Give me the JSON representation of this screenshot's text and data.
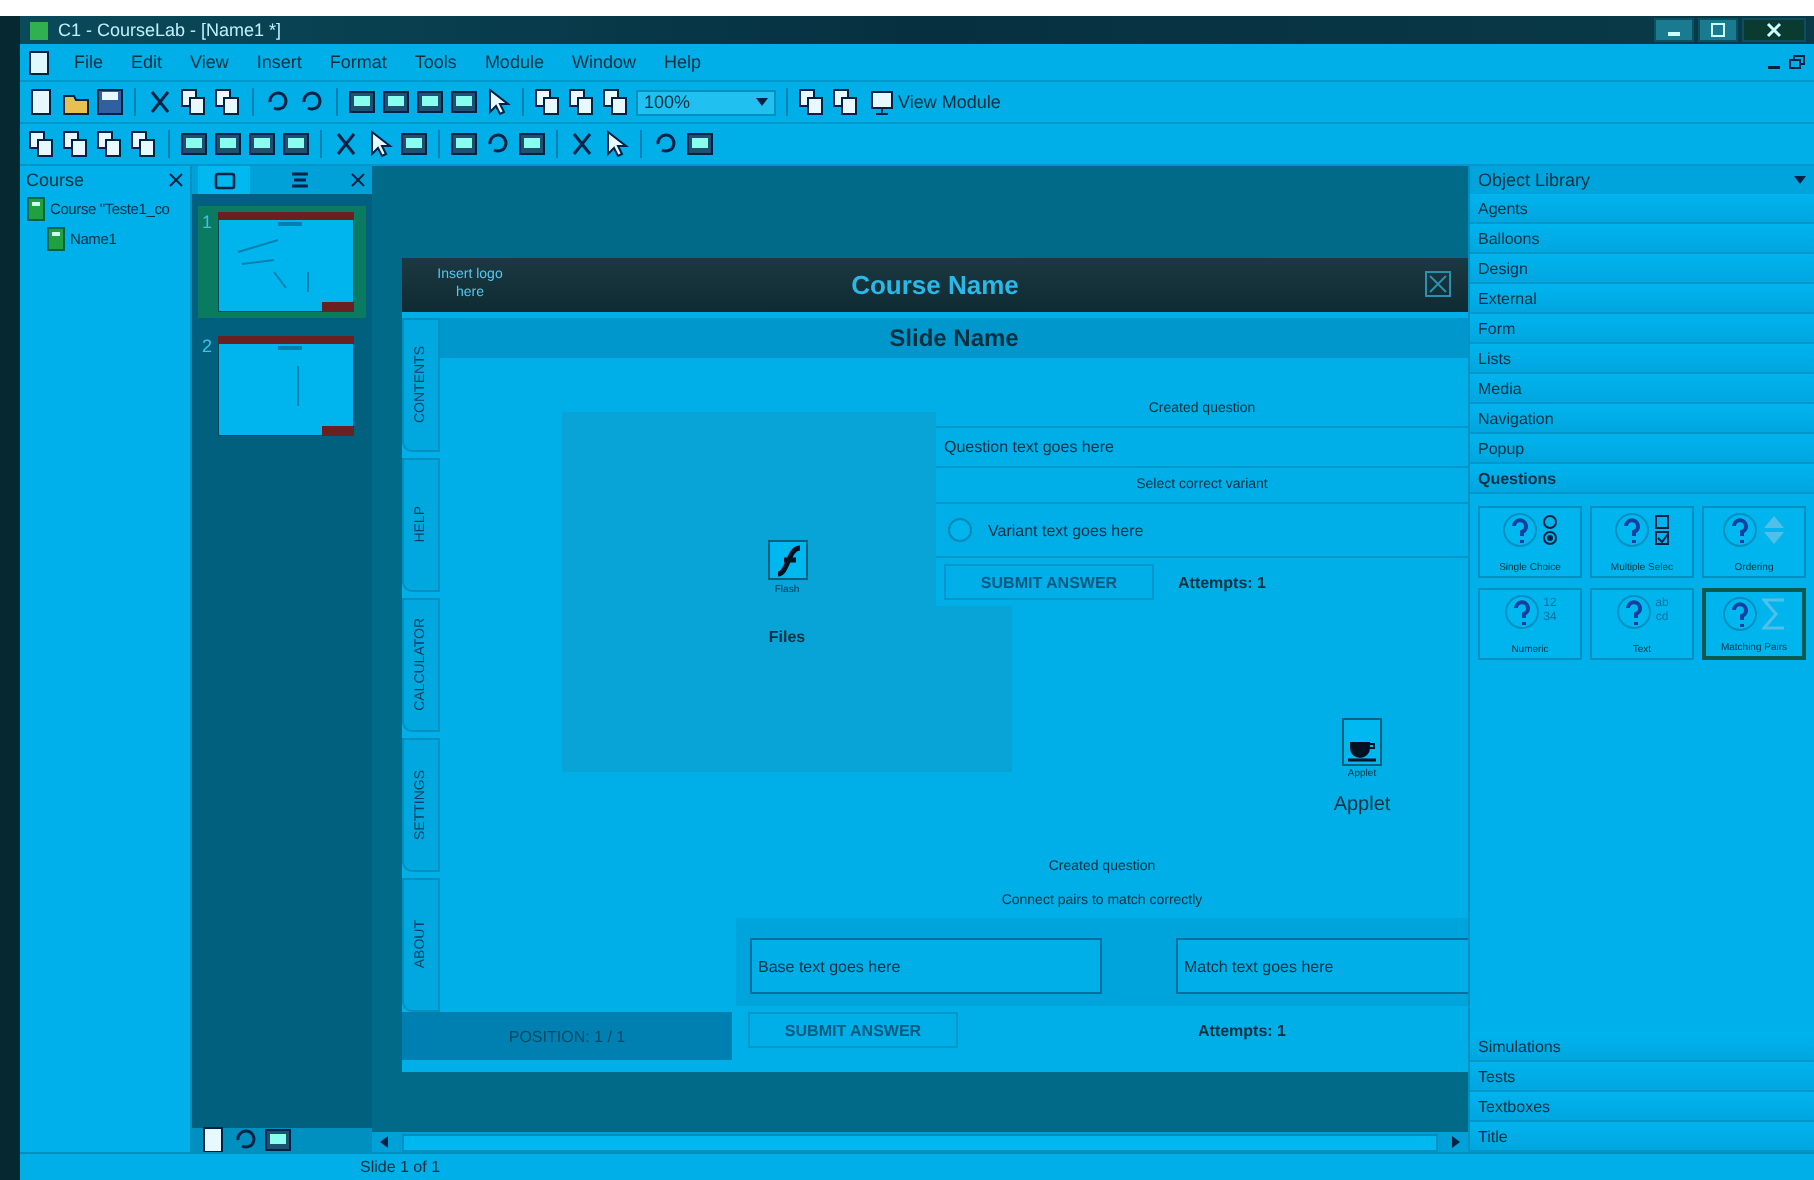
{
  "window": {
    "title": "C1 - CourseLab - [Name1 *]"
  },
  "menu": [
    "File",
    "Edit",
    "View",
    "Insert",
    "Format",
    "Tools",
    "Module",
    "Window",
    "Help"
  ],
  "toolbar": {
    "zoom": "100%",
    "view_module": "View Module"
  },
  "course_panel": {
    "title": "Course",
    "tree": [
      {
        "label": "Course \"Teste1_co",
        "children": [
          {
            "label": "Name1"
          }
        ]
      }
    ]
  },
  "slides_panel": {
    "thumbnails": [
      {
        "number": "1",
        "selected": true
      },
      {
        "number": "2",
        "selected": false
      }
    ]
  },
  "slide": {
    "logo": "Insert logo here",
    "course_name": "Course Name",
    "slide_name": "Slide Name",
    "side_tabs": [
      "CONTENTS",
      "HELP",
      "CALCULATOR",
      "SETTINGS",
      "ABOUT"
    ],
    "position": "POSITION: 1 / 1",
    "flash": {
      "icon_label": "Flash",
      "label": "Files"
    },
    "applet": {
      "icon_label": "Applet",
      "label": "Applet"
    },
    "question_1": {
      "heading": "Created question",
      "text": "Question text goes here",
      "instruction": "Select correct variant",
      "variants": [
        {
          "label": "Variant text goes here",
          "selected": false
        }
      ],
      "submit": {
        "label": "SUBMIT ANSWER",
        "disabled": true
      },
      "attempts": "Attempts: 1"
    },
    "question_2": {
      "heading": "Created question",
      "instruction": "Connect pairs to match correctly",
      "base": "Base text goes here",
      "match": "Match text goes here",
      "submit": {
        "label": "SUBMIT ANSWER",
        "disabled": true
      },
      "attempts": "Attempts: 1"
    }
  },
  "library": {
    "title": "Object Library",
    "groups_above": [
      {
        "label": "Agents"
      },
      {
        "label": "Balloons"
      },
      {
        "label": "Design"
      },
      {
        "label": "External"
      },
      {
        "label": "Form"
      },
      {
        "label": "Lists"
      },
      {
        "label": "Media"
      },
      {
        "label": "Navigation"
      },
      {
        "label": "Popup"
      }
    ],
    "open_group": {
      "label": "Questions",
      "expanded": true,
      "tiles": [
        {
          "label": "Single Choice",
          "kind": "radio",
          "selected": false
        },
        {
          "label": "Multiple Selec",
          "kind": "checkbox",
          "selected": false
        },
        {
          "label": "Ordering",
          "kind": "arrows",
          "selected": false
        },
        {
          "label": "Numeric",
          "kind": "text",
          "side_text": [
            "12",
            "34"
          ],
          "selected": false
        },
        {
          "label": "Text",
          "kind": "text",
          "side_text": [
            "ab",
            "cd"
          ],
          "selected": false
        },
        {
          "label": "Matching Pairs",
          "kind": "sigma",
          "selected": true
        }
      ]
    },
    "groups_below": [
      {
        "label": "Simulations"
      },
      {
        "label": "Tests"
      },
      {
        "label": "Textboxes"
      },
      {
        "label": "Title"
      }
    ]
  },
  "status_bar": {
    "text": "Slide 1 of 1"
  }
}
